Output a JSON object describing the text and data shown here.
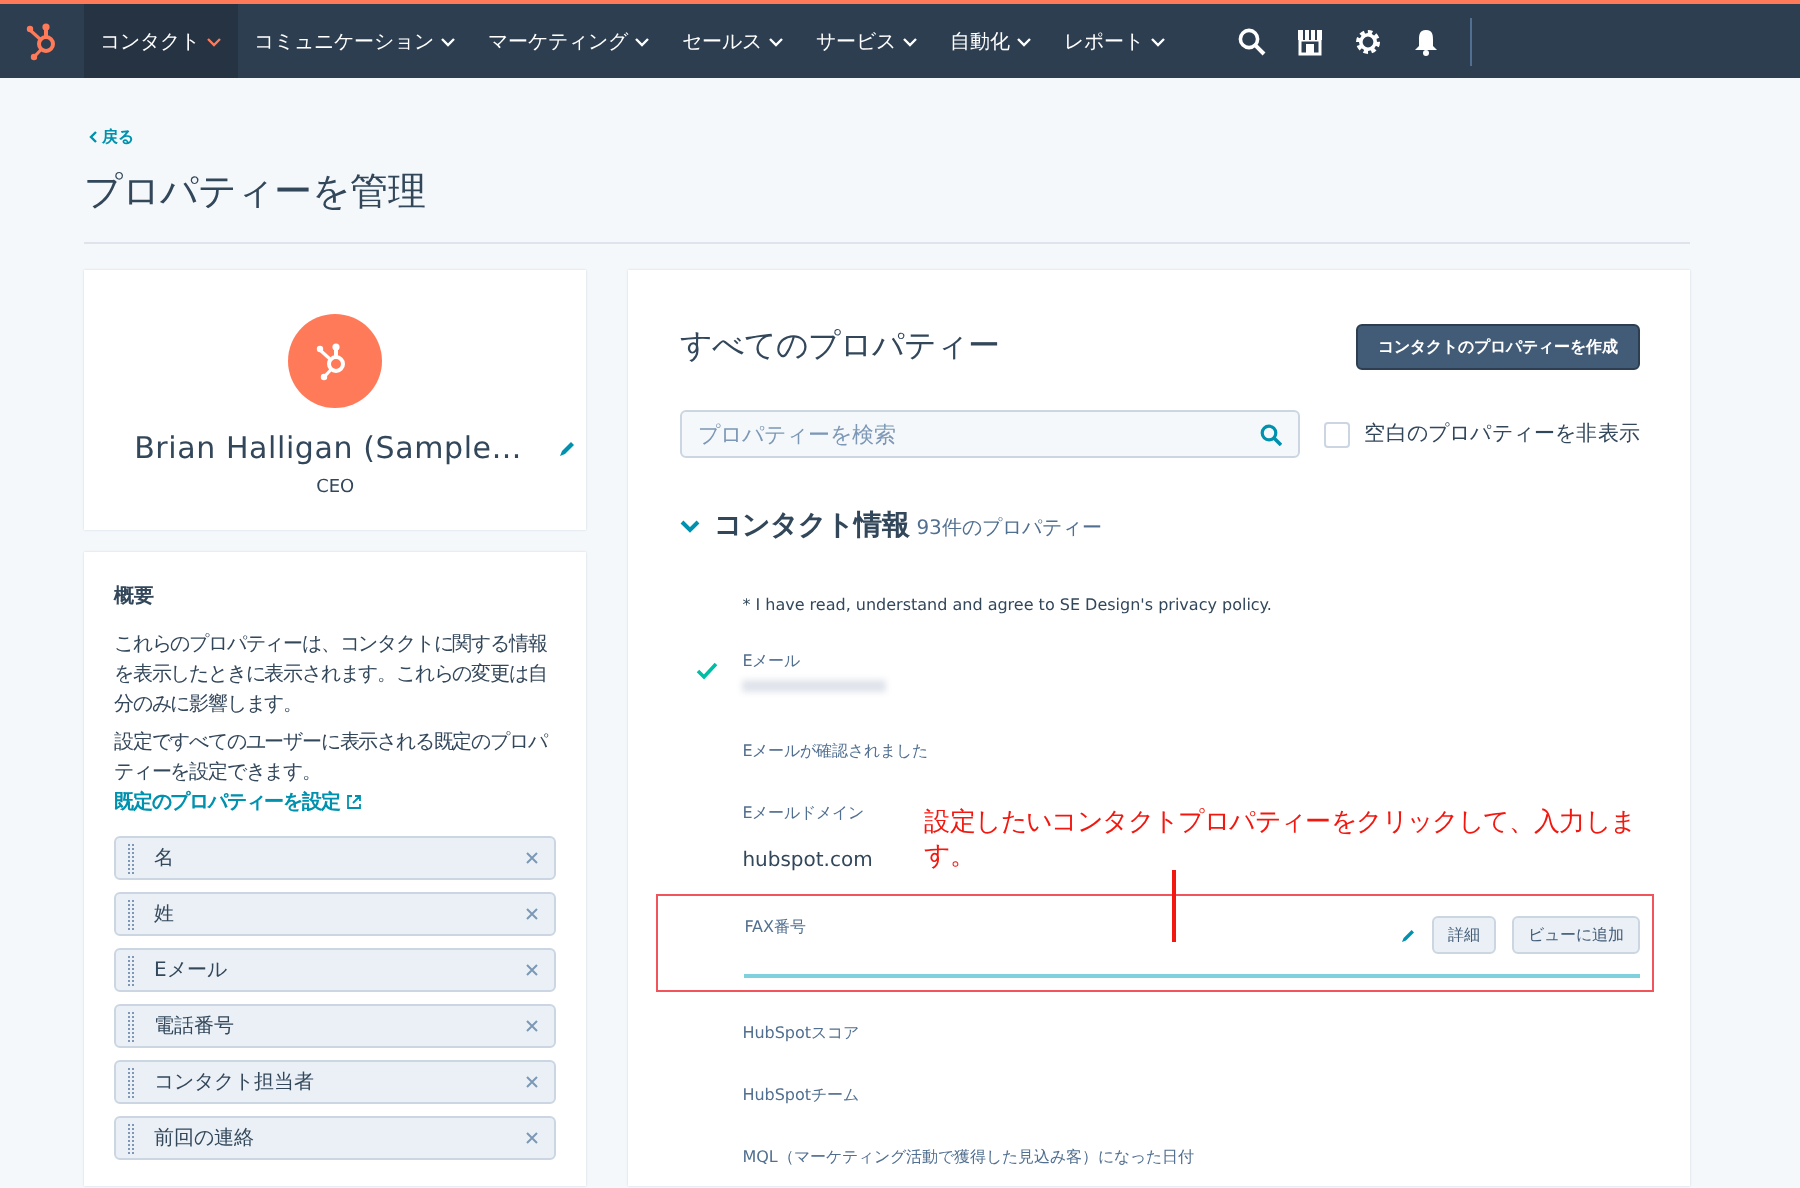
{
  "nav": {
    "items": [
      {
        "label": "コンタクト",
        "selected": true
      },
      {
        "label": "コミュニケーション",
        "selected": false
      },
      {
        "label": "マーケティング",
        "selected": false
      },
      {
        "label": "セールス",
        "selected": false
      },
      {
        "label": "サービス",
        "selected": false
      },
      {
        "label": "自動化",
        "selected": false
      },
      {
        "label": "レポート",
        "selected": false
      }
    ]
  },
  "back_link": "戻る",
  "page_title": "プロパティーを管理",
  "profile": {
    "name": "Brian Halligan (Sample…",
    "job_title": "CEO"
  },
  "overview": {
    "title": "概要",
    "description": "これらのプロパティーは、コンタクトに関する情報を表示したときに表示されます。これらの変更は自分のみに影響します。",
    "settings_text": "設定ですべてのユーザーに表示される既定のプロパティーを設定できます。",
    "settings_link": "既定のプロパティーを設定",
    "properties": [
      "名",
      "姓",
      "Eメール",
      "電話番号",
      "コンタクト担当者",
      "前回の連絡"
    ]
  },
  "all_properties": {
    "title": "すべてのプロパティー",
    "create_button": "コンタクトのプロパティーを作成",
    "search": {
      "placeholder": "プロパティーを検索"
    },
    "hide_empty": {
      "label": "空白のプロパティーを非表示",
      "checked": false
    },
    "group": {
      "title": "コンタクト情報",
      "count": "93件のプロパティー",
      "expanded": true,
      "properties": [
        {
          "kind": "note",
          "label": "* I have read, understand and agree to SE Design's privacy policy.",
          "verified": false
        },
        {
          "kind": "blurred",
          "label": "Eメール",
          "verified": true
        },
        {
          "kind": "field",
          "label": "Eメールが確認されました",
          "verified": false
        },
        {
          "kind": "field",
          "label": "Eメールドメイン",
          "value": "hubspot.com",
          "verified": false
        },
        {
          "kind": "editing",
          "label": "FAX番号",
          "buttons": [
            "詳細",
            "ビューに追加"
          ],
          "verified": false,
          "highlighted": true
        },
        {
          "kind": "field",
          "label": "HubSpotスコア",
          "verified": false
        },
        {
          "kind": "field",
          "label": "HubSpotチーム",
          "verified": false
        },
        {
          "kind": "field",
          "label": "MQL（マーケティング活動で獲得した見込み客）になった日付",
          "verified": false
        }
      ]
    }
  },
  "annotation": "設定したいコンタクトプロパティーをクリックして、入力します。"
}
